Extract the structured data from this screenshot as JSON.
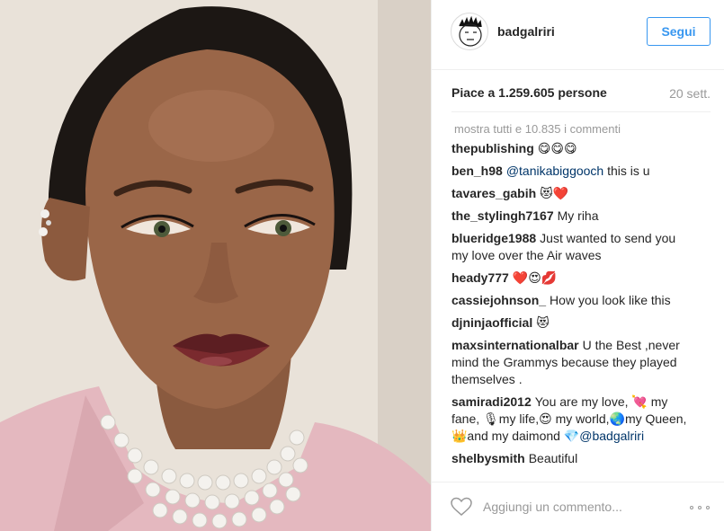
{
  "post": {
    "username": "badgalriri",
    "follow_label": "Segui",
    "likes_text": "Piace a 1.259.605 persone",
    "timestamp": "20 sett."
  },
  "comments": {
    "view_all": "mostra tutti e 10.835 i commenti",
    "items": [
      {
        "user": "thepublishing",
        "text": "😋😋😋"
      },
      {
        "user": "ben_h98",
        "mention": "@tanikabiggooch",
        "text": "this is u"
      },
      {
        "user": "tavares_gabih",
        "text": "😻❤️"
      },
      {
        "user": "the_stylingh7167",
        "text": "My riha"
      },
      {
        "user": "blueridge1988",
        "text": "Just wanted to send you my love over the Air waves"
      },
      {
        "user": "heady777",
        "text": "❤️😍💋"
      },
      {
        "user": "cassiejohnson_",
        "text": "How you look like this"
      },
      {
        "user": "djninjaofficial",
        "text": "😻"
      },
      {
        "user": "maxsinternationalbar",
        "text": "U the Best ,never mind the Grammys because they played themselves ."
      },
      {
        "user": "samiradi2012",
        "text": "You are my love, 💘 my fane, 🎙my life,😍 my world,🌏my Queen,👑and my daimond 💎",
        "mention": "@badgalriri"
      },
      {
        "user": "shelbysmith",
        "text": "Beautiful"
      }
    ]
  },
  "footer": {
    "comment_placeholder": "Aggiungi un commento...",
    "heart_icon": "heart-outline-icon",
    "more_icon": "more-options-icon"
  },
  "colors": {
    "accent": "#3897f0",
    "mention": "#003569",
    "muted": "#999999"
  }
}
